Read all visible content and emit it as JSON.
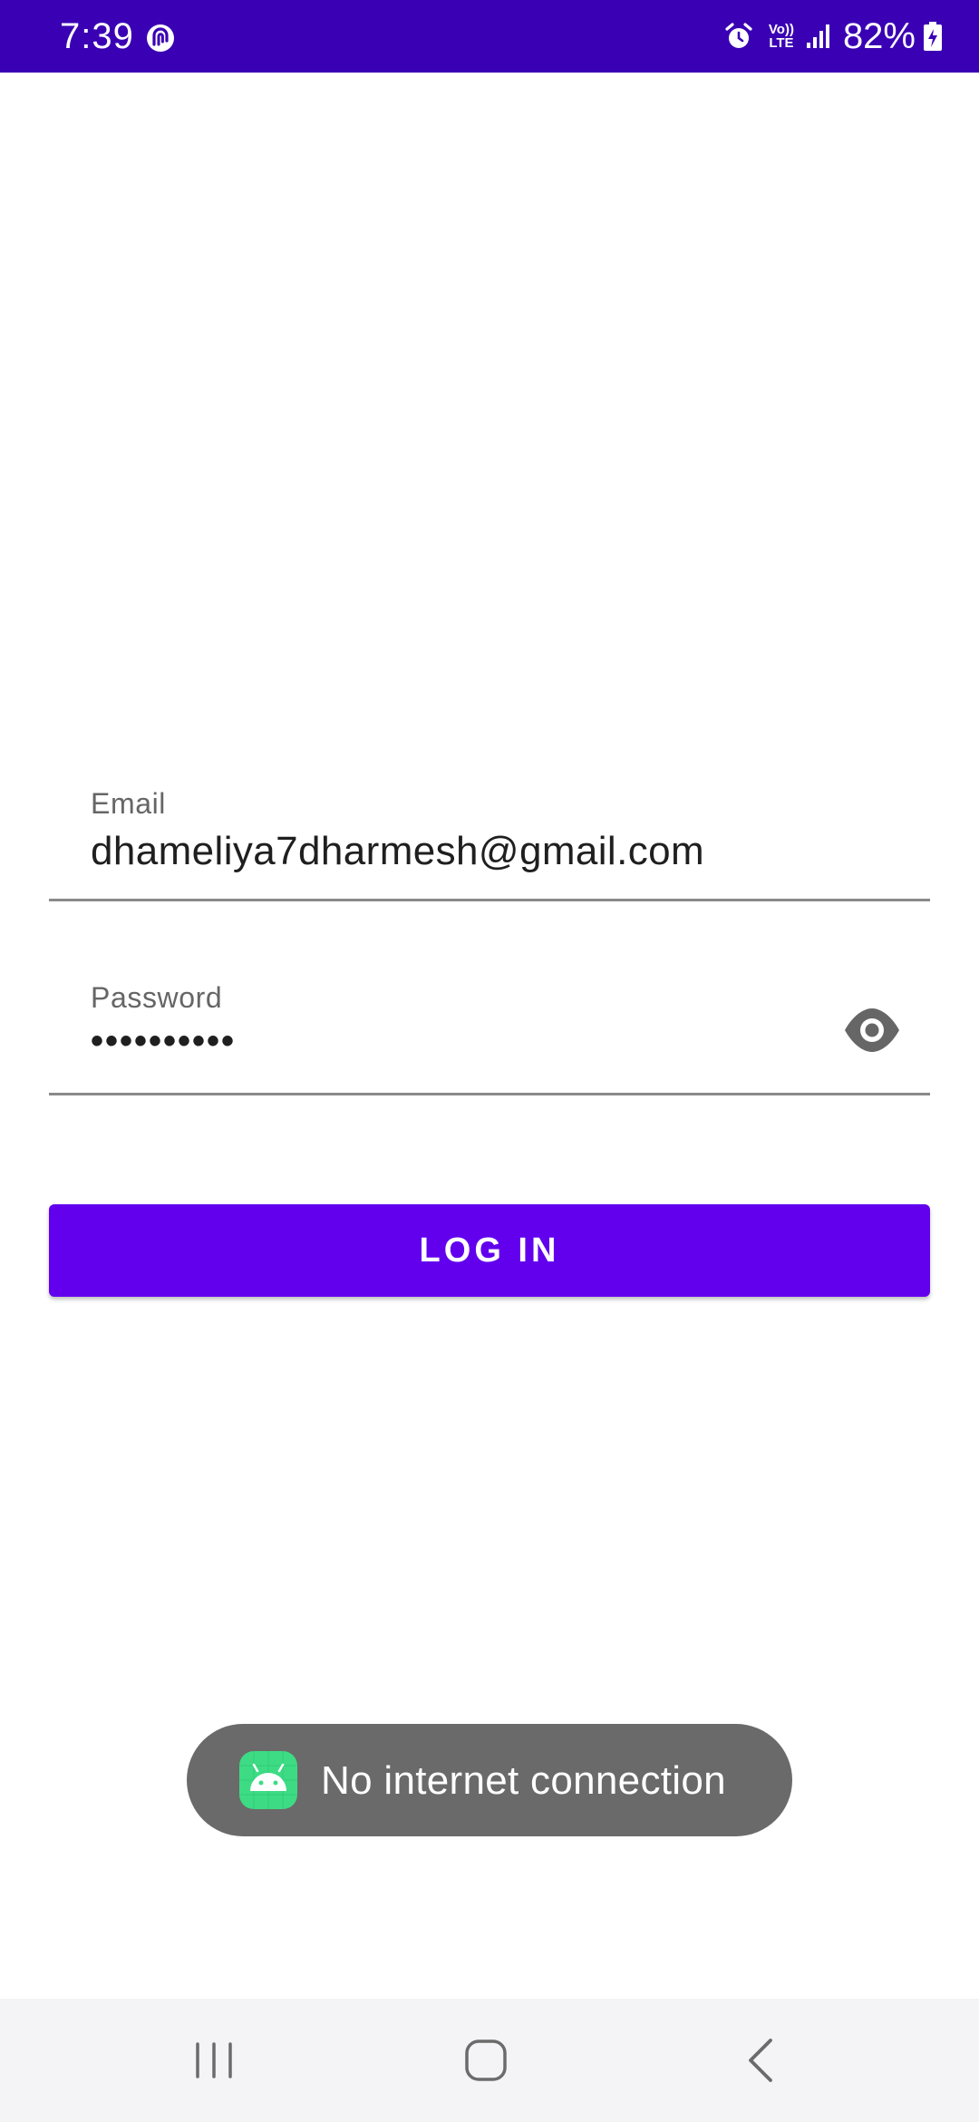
{
  "status_bar": {
    "time": "7:39",
    "battery_percent": "82%",
    "network_label": "Vo)) LTE",
    "icons": [
      "sync-app-icon",
      "alarm-icon",
      "volte-icon",
      "signal-icon",
      "battery-charging-icon"
    ],
    "background_color": "#3a00b4"
  },
  "form": {
    "email": {
      "label": "Email",
      "value": "dhameliya7dharmesh@gmail.com"
    },
    "password": {
      "label": "Password",
      "value": "••••••••••",
      "toggle_icon": "eye-icon"
    }
  },
  "login_button": {
    "label": "LOG IN",
    "color": "#6200ee"
  },
  "toast": {
    "message": "No internet connection",
    "icon": "android-icon"
  },
  "nav_bar": {
    "buttons": [
      "recent-apps",
      "home",
      "back"
    ]
  }
}
